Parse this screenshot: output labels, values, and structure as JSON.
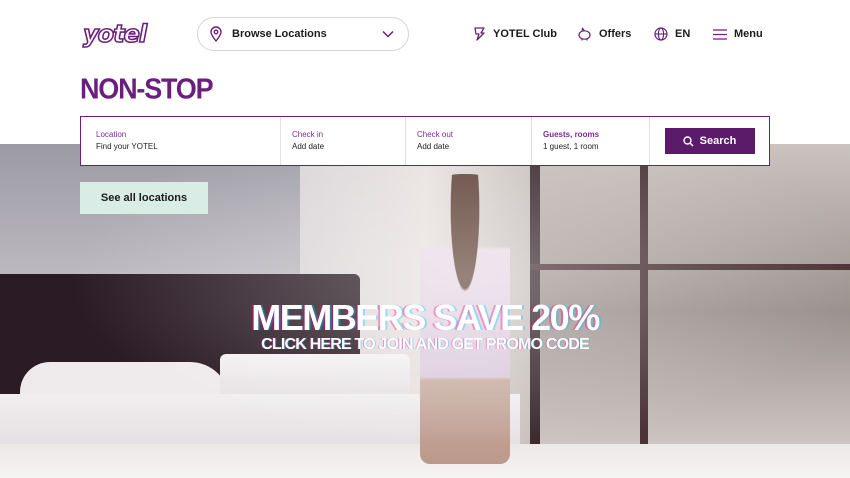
{
  "header": {
    "logo_text": "yotel",
    "browse_label": "Browse Locations",
    "nav": {
      "club": "YOTEL Club",
      "offers": "Offers",
      "language": "EN",
      "menu": "Menu"
    }
  },
  "headline": "NON-STOP",
  "search": {
    "location": {
      "label": "Location",
      "value": "Find your YOTEL"
    },
    "checkin": {
      "label": "Check in",
      "value": "Add date"
    },
    "checkout": {
      "label": "Check out",
      "value": "Add date"
    },
    "guests": {
      "label": "Guests, rooms",
      "value": "1 guest, 1 room"
    },
    "button": "Search"
  },
  "see_all_label": "See all locations",
  "promo": {
    "title": "MEMBERS SAVE 20%",
    "subtitle": "CLICK HERE TO JOIN AND GET PROMO CODE"
  },
  "colors": {
    "brand_purple": "#6b1f7d",
    "button_purple": "#5c1a6b",
    "mint": "#d9ece6"
  },
  "icons": [
    "location-pin-icon",
    "chevron-down-icon",
    "club-icon",
    "piggy-bank-icon",
    "globe-icon",
    "hamburger-menu-icon",
    "search-icon"
  ]
}
